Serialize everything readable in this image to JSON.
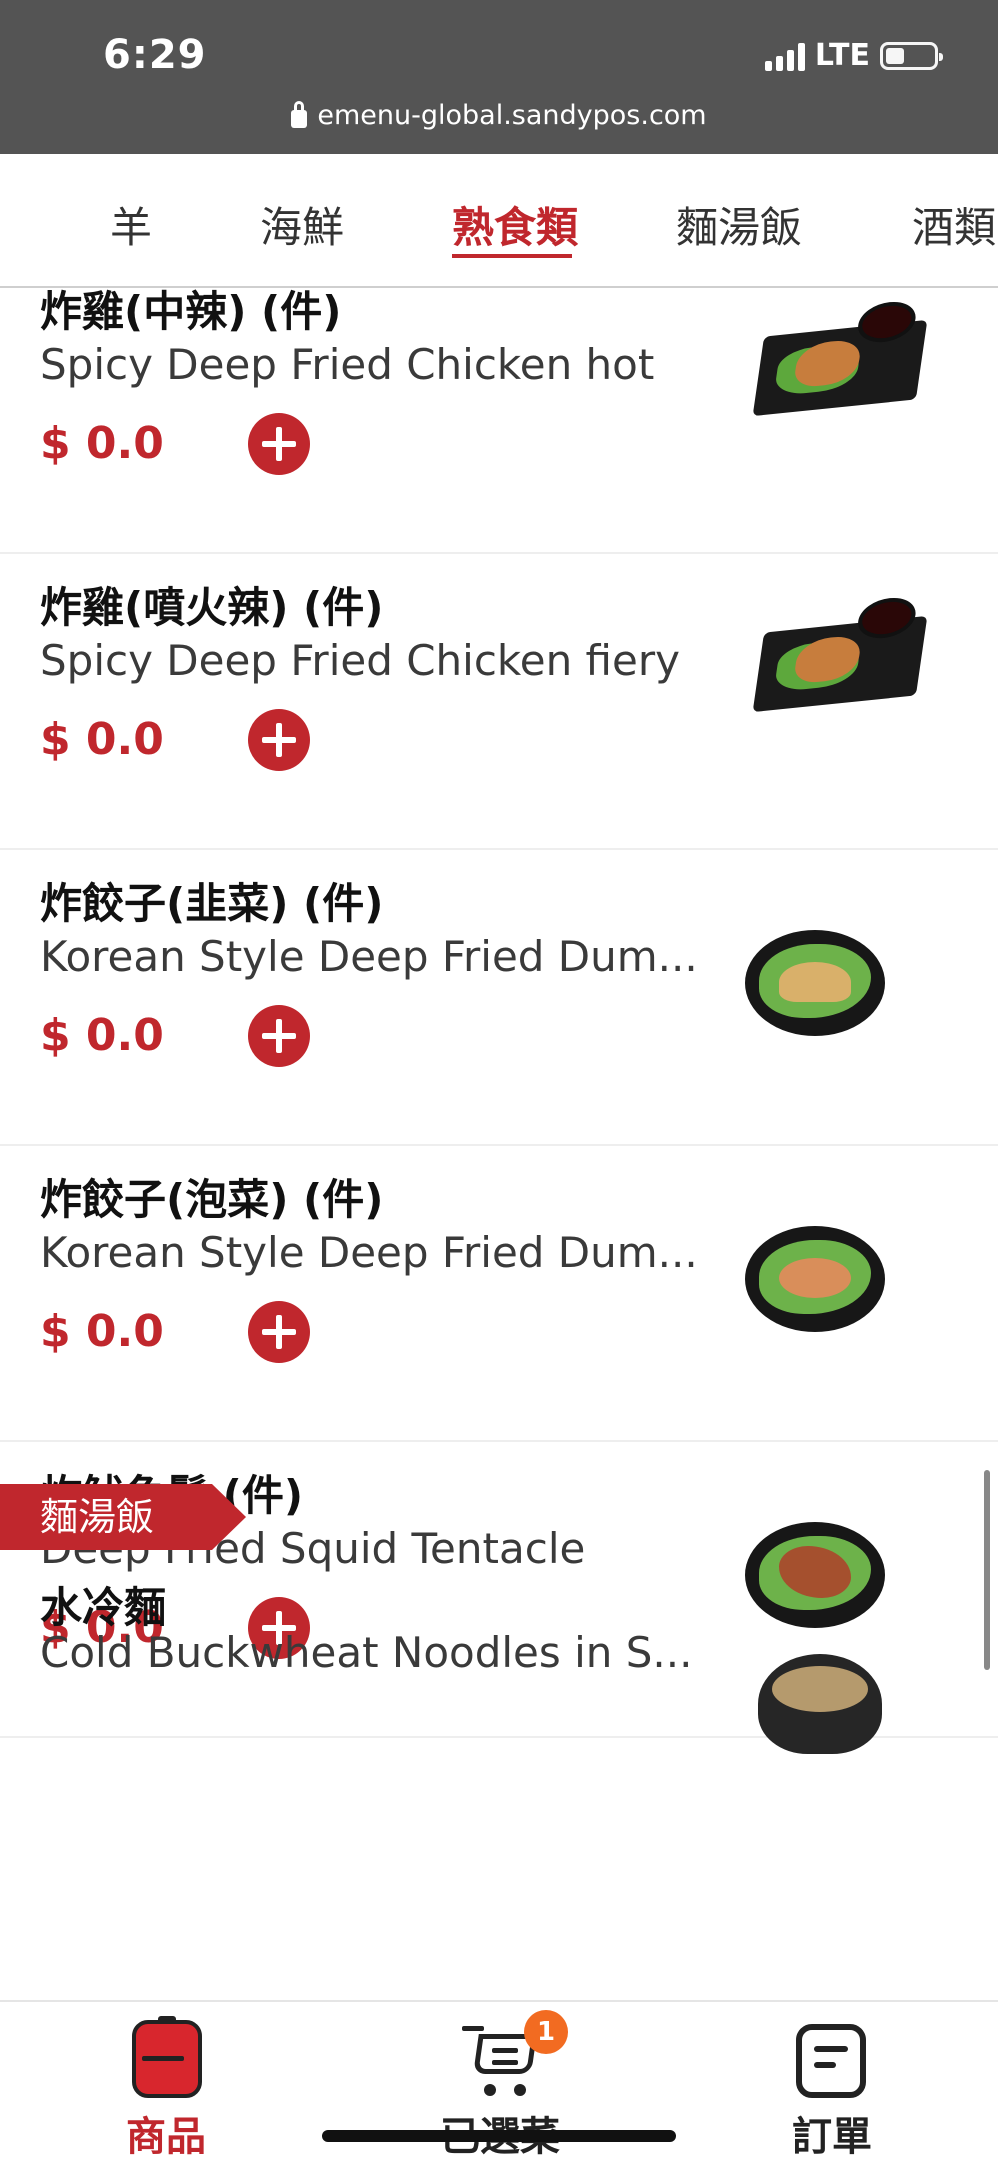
{
  "status_bar": {
    "time": "6:29",
    "network": "LTE",
    "url": "emenu-global.sandypos.com"
  },
  "tabs": [
    {
      "label": "羊"
    },
    {
      "label": "海鮮"
    },
    {
      "label": "熟食類",
      "active": true
    },
    {
      "label": "麵湯飯"
    },
    {
      "label": "酒類"
    }
  ],
  "items": [
    {
      "name": "炸雞(中辣) (件)",
      "english": "Spicy Deep Fried Chicken hot",
      "price": "$ 0.0",
      "image": "fried-chicken-plate"
    },
    {
      "name": "炸雞(噴火辣) (件)",
      "english": "Spicy Deep Fried Chicken fiery",
      "price": "$ 0.0",
      "image": "fried-chicken-plate"
    },
    {
      "name": "炸餃子(韭菜) (件)",
      "english": "Korean Style Deep Fried Dum...",
      "price": "$ 0.0",
      "image": "fried-dumpling-plate"
    },
    {
      "name": "炸餃子(泡菜) (件)",
      "english": "Korean Style Deep Fried Dum...",
      "price": "$ 0.0",
      "image": "kimchi-dumpling-plate"
    },
    {
      "name": "炸魷魚鬚 (件)",
      "english": "Deep Fried Squid Tentacle",
      "price": "$ 0.0",
      "image": "fried-squid-plate"
    }
  ],
  "section": {
    "label": "麵湯飯",
    "first_item": {
      "name": "水冷麵",
      "english": "Cold Buckwheat Noodles in S...",
      "image": "cold-noodle-bowl"
    }
  },
  "bottom_nav": {
    "products": "商品",
    "cart": "已選菜",
    "cart_count": "1",
    "orders": "訂單"
  },
  "colors": {
    "accent": "#c0272d",
    "status_bar": "#545454",
    "badge": "#f26b21"
  }
}
